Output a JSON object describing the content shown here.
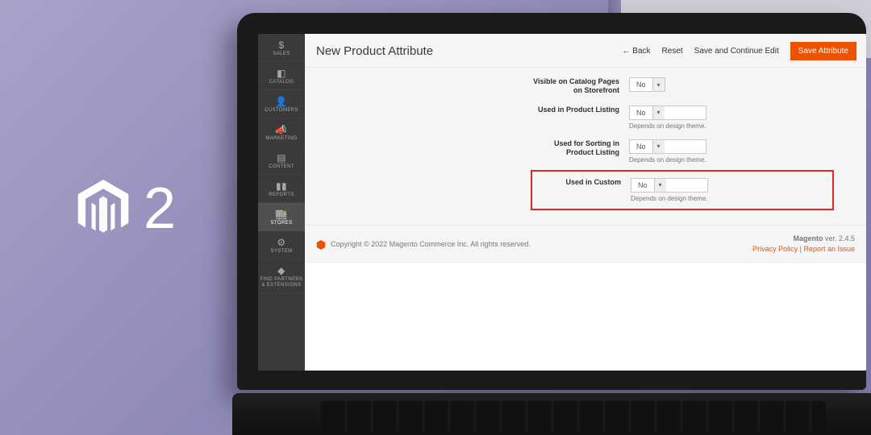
{
  "logo_number": "2",
  "header": {
    "title": "New Product Attribute",
    "actions": {
      "back": "Back",
      "reset": "Reset",
      "save_continue": "Save and Continue Edit",
      "save": "Save Attribute"
    }
  },
  "sidebar": {
    "items": [
      {
        "label": "SALES"
      },
      {
        "label": "CATALOG"
      },
      {
        "label": "CUSTOMERS"
      },
      {
        "label": "MARKETING"
      },
      {
        "label": "CONTENT"
      },
      {
        "label": "REPORTS"
      },
      {
        "label": "STORES",
        "active": true
      },
      {
        "label": "SYSTEM"
      },
      {
        "label": "FIND PARTNERS & EXTENSIONS"
      }
    ]
  },
  "form": {
    "rows": [
      {
        "label": "Visible on Catalog Pages on Storefront",
        "value": "No",
        "hint": ""
      },
      {
        "label": "Used in Product Listing",
        "value": "No",
        "hint": "Depends on design theme."
      },
      {
        "label": "Used for Sorting in Product Listing",
        "value": "No",
        "hint": "Depends on design theme."
      },
      {
        "label": "Used in Custom",
        "value": "No",
        "hint": "Depends on design theme.",
        "highlight": true
      }
    ]
  },
  "footer": {
    "copyright": "Copyright © 2022 Magento Commerce Inc. All rights reserved.",
    "version_label": "Magento",
    "version_value": "ver. 2.4.5",
    "privacy": "Privacy Policy",
    "report": "Report an Issue"
  },
  "colors": {
    "accent": "#eb5202",
    "highlight_border": "#e02626",
    "sidebar_bg": "#3a3a3a"
  }
}
